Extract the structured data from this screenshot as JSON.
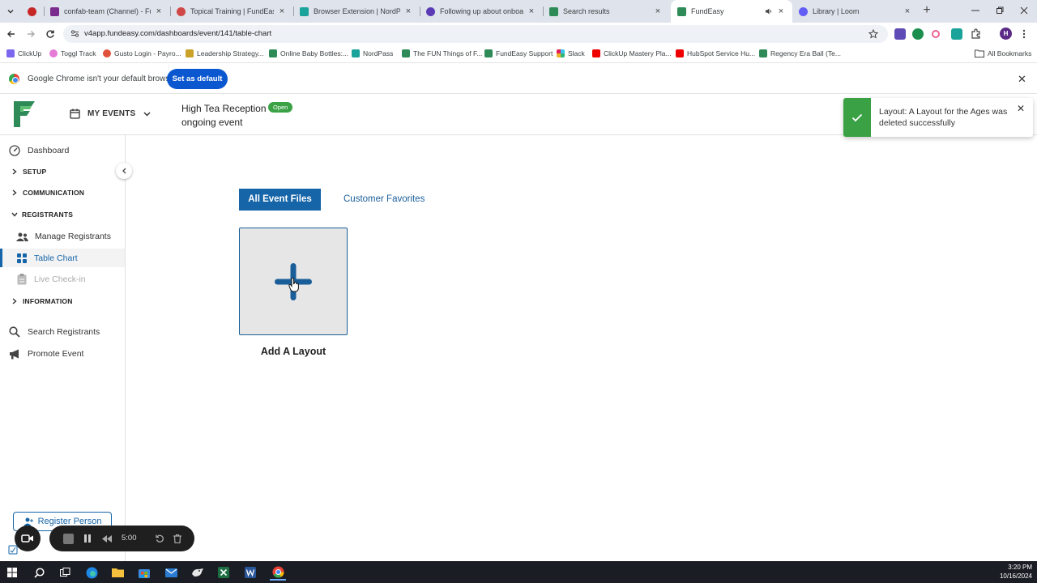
{
  "browser": {
    "tabs": [
      {
        "title": "confab-team (Channel) - Fund",
        "color": "#7b2d8e"
      },
      {
        "title": "Topical Training | FundEasy (L",
        "color": "#d14848"
      },
      {
        "title": "Browser Extension | NordPass",
        "color": "#1aa39a"
      },
      {
        "title": "Following up about onboardin",
        "color": "#5b3bb5"
      },
      {
        "title": "Search results",
        "color": "#2e8b57"
      },
      {
        "title": "FundEasy",
        "color": "#2e8b57"
      },
      {
        "title": "Library | Loom",
        "color": "#625df5"
      }
    ],
    "url": "v4app.fundeasy.com/dashboards/event/141/table-chart",
    "profile_initial": "H",
    "bookmarks": [
      "ClickUp",
      "Toggl Track",
      "Gusto Login - Payro...",
      "Leadership Strategy...",
      "Online Baby Bottles:...",
      "NordPass",
      "The FUN Things of F...",
      "FundEasy Support",
      "Slack",
      "ClickUp Mastery Pla...",
      "HubSpot Service Hu...",
      "Regency Era Ball (Te..."
    ],
    "all_bookmarks": "All Bookmarks",
    "infobar": {
      "message": "Google Chrome isn't your default browser",
      "button": "Set as default"
    }
  },
  "header": {
    "my_events": "MY EVENTS",
    "event_title": "High Tea Reception",
    "event_badge": "Open",
    "event_status": "ongoing event"
  },
  "toast": {
    "message": "Layout: A Layout for the Ages was deleted successfully"
  },
  "sidebar": {
    "dashboard": "Dashboard",
    "setup": "SETUP",
    "communication": "COMMUNICATION",
    "registrants": "REGISTRANTS",
    "manage_registrants": "Manage Registrants",
    "table_chart": "Table Chart",
    "live_checkin": "Live Check-in",
    "information": "INFORMATION",
    "search_registrants": "Search Registrants",
    "promote_event": "Promote Event",
    "register_person": "Register Person"
  },
  "main": {
    "tab_all": "All Event Files",
    "tab_favorites": "Customer Favorites",
    "add_layout": "Add A Layout"
  },
  "recorder": {
    "time": "5:00"
  },
  "taskbar": {
    "time": "3:20 PM",
    "date": "10/16/2024"
  },
  "colors": {
    "brand": "#1565a8",
    "success": "#3aa245"
  }
}
